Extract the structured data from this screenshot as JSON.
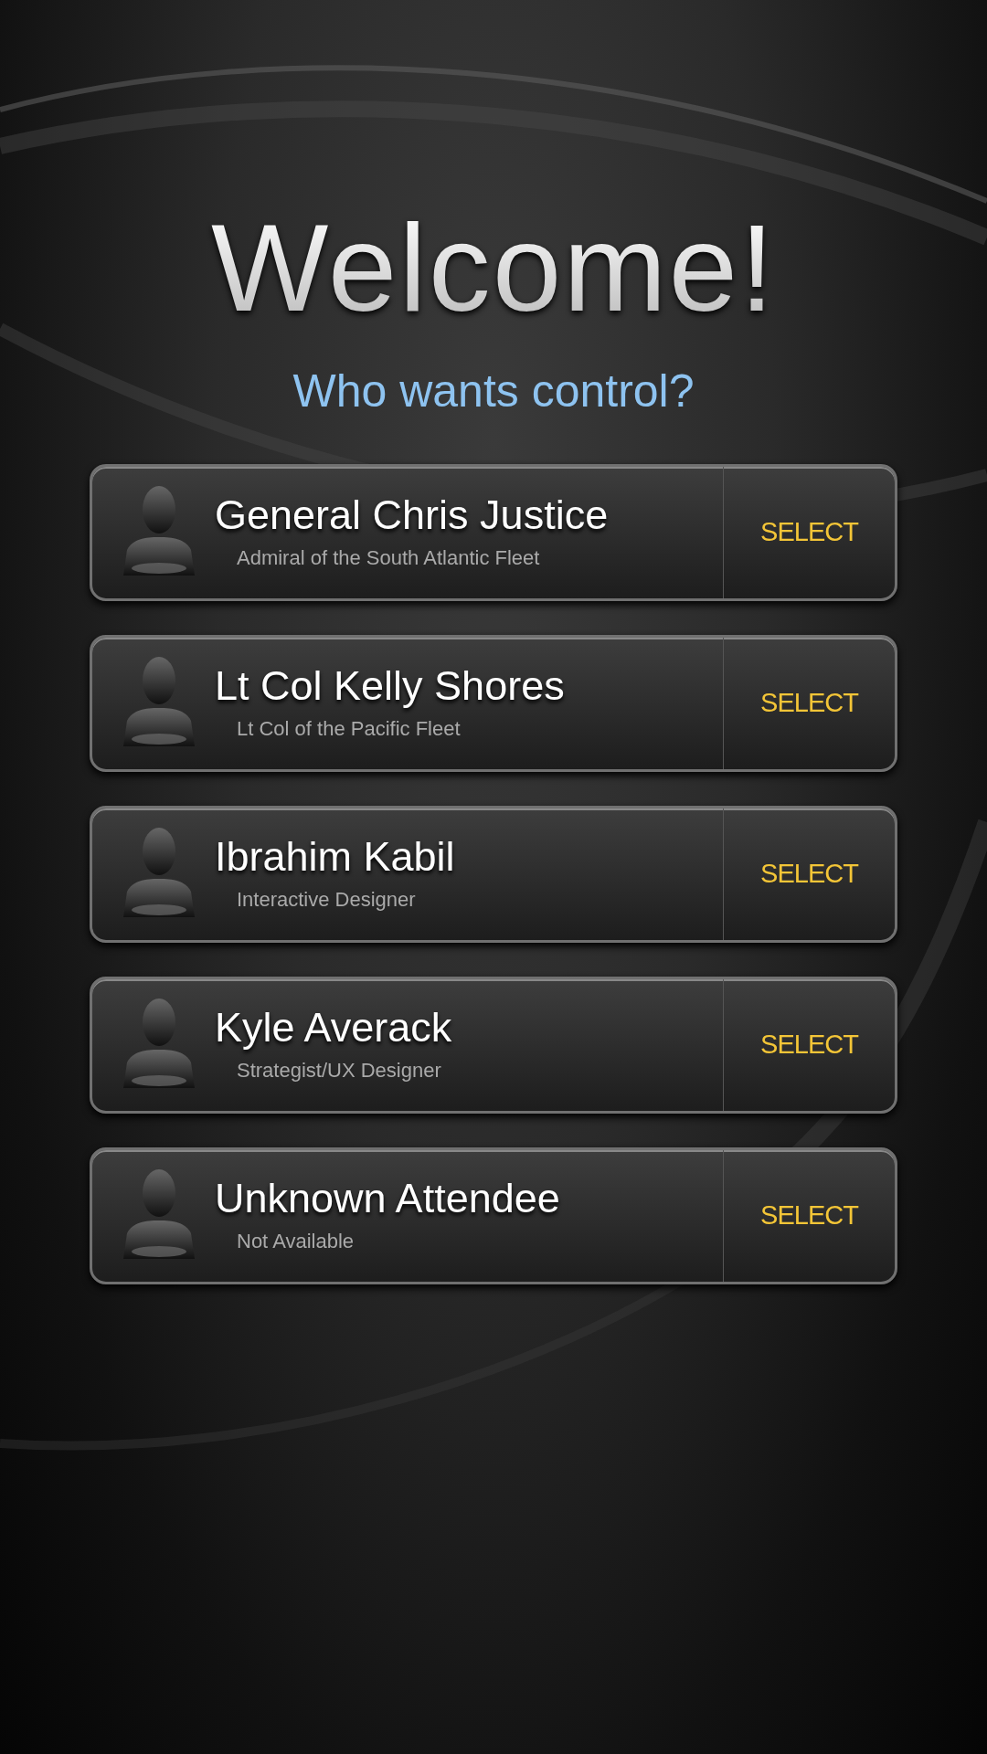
{
  "title": "Welcome!",
  "subtitle": "Who wants control?",
  "users": [
    {
      "name": "General Chris Justice",
      "role": "Admiral of the South Atlantic Fleet",
      "action": "SELECT"
    },
    {
      "name": "Lt Col Kelly Shores",
      "role": "Lt Col of the Pacific Fleet",
      "action": "SELECT"
    },
    {
      "name": "Ibrahim Kabil",
      "role": "Interactive Designer",
      "action": "SELECT"
    },
    {
      "name": "Kyle Averack",
      "role": "Strategist/UX Designer",
      "action": "SELECT"
    },
    {
      "name": "Unknown Attendee",
      "role": "Not Available",
      "action": "SELECT"
    }
  ]
}
